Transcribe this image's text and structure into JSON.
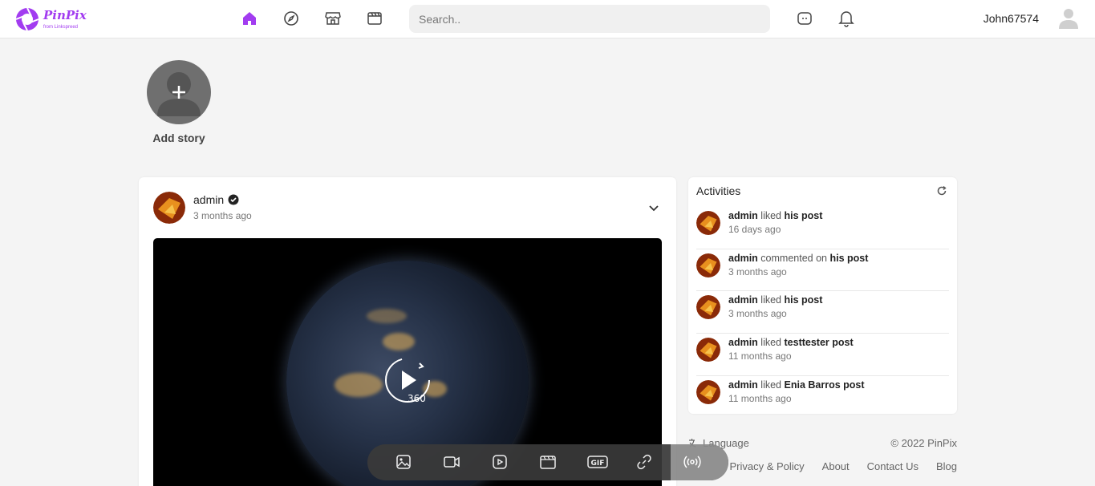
{
  "header": {
    "logo_name": "PinPix",
    "logo_sub": "from Linkspreed",
    "search_placeholder": "Search..",
    "username": "John67574",
    "nav": [
      {
        "icon": "home-icon",
        "active": true
      },
      {
        "icon": "compass-icon",
        "active": false
      },
      {
        "icon": "store-icon",
        "active": false
      },
      {
        "icon": "clapperboard-icon",
        "active": false
      }
    ],
    "accent": "#a23cf0"
  },
  "story": {
    "label": "Add story"
  },
  "post": {
    "author": "admin",
    "time": "3 months ago",
    "video_badge": "360"
  },
  "activities": {
    "title": "Activities",
    "items": [
      {
        "user": "admin",
        "action": "liked",
        "target": "his post",
        "time": "16 days ago"
      },
      {
        "user": "admin",
        "action": "commented on",
        "target": "his post",
        "time": "3 months ago"
      },
      {
        "user": "admin",
        "action": "liked",
        "target": "his post",
        "time": "3 months ago"
      },
      {
        "user": "admin",
        "action": "liked",
        "target": "testtester post",
        "time": "11 months ago"
      },
      {
        "user": "admin",
        "action": "liked",
        "target": "Enia Barros post",
        "time": "11 months ago"
      }
    ]
  },
  "footer": {
    "language": "Language",
    "copyright": "© 2022 PinPix",
    "links": [
      "Privacy & Policy",
      "About",
      "Contact Us",
      "Blog"
    ]
  },
  "toolbar": {
    "gif_label": "GIF",
    "icons": [
      "image-icon",
      "video-camera-icon",
      "play-video-icon",
      "clapperboard-icon",
      "gif-icon",
      "link-icon",
      "live-broadcast-icon"
    ]
  }
}
